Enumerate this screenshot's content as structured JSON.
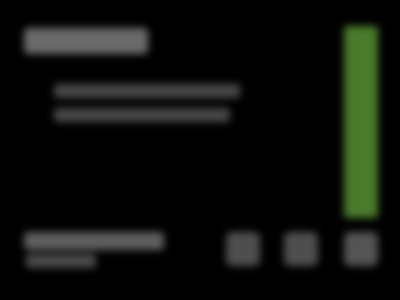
{
  "screen": {
    "background": "#000000",
    "accent": "#4a7a2c"
  },
  "header": {
    "title": ""
  },
  "content": {
    "line_1": "",
    "line_2": ""
  },
  "side_meter": {
    "color": "#4a7a2c"
  },
  "footer": {
    "label": "",
    "sublabel": "",
    "icons": [
      "button-icon",
      "button-icon",
      "button-icon"
    ]
  }
}
